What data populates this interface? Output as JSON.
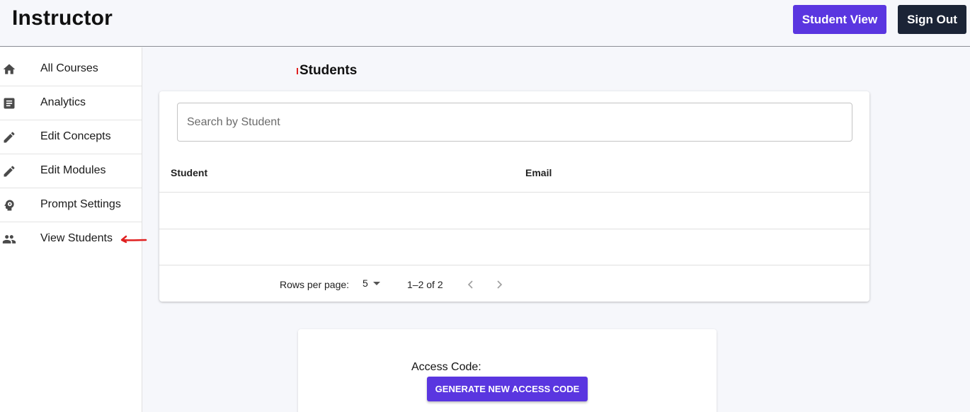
{
  "header": {
    "title": "Instructor",
    "student_view_label": "Student View",
    "sign_out_label": "Sign Out"
  },
  "sidebar": {
    "items": [
      {
        "label": "All Courses",
        "icon": "home-icon"
      },
      {
        "label": "Analytics",
        "icon": "analytics-icon"
      },
      {
        "label": "Edit Concepts",
        "icon": "pencil-icon"
      },
      {
        "label": "Edit Modules",
        "icon": "pencil-icon"
      },
      {
        "label": "Prompt Settings",
        "icon": "psychology-icon"
      },
      {
        "label": "View Students",
        "icon": "people-icon"
      }
    ]
  },
  "main": {
    "title": "Students",
    "search": {
      "placeholder": "Search by Student",
      "value": ""
    },
    "table": {
      "columns": [
        "Student",
        "Email"
      ],
      "rows": [
        {
          "student": "",
          "email": ""
        },
        {
          "student": "",
          "email": ""
        }
      ]
    },
    "pagination": {
      "rows_per_page_label": "Rows per page:",
      "rows_per_page_value": "5",
      "range_text": "1–2 of 2"
    }
  },
  "access": {
    "label": "Access Code:",
    "generate_label": "GENERATE NEW ACCESS CODE"
  },
  "colors": {
    "primary": "#5a36e0",
    "dark_button": "#1b2436",
    "annotation": "#e02020",
    "background": "#f6f7fb"
  }
}
